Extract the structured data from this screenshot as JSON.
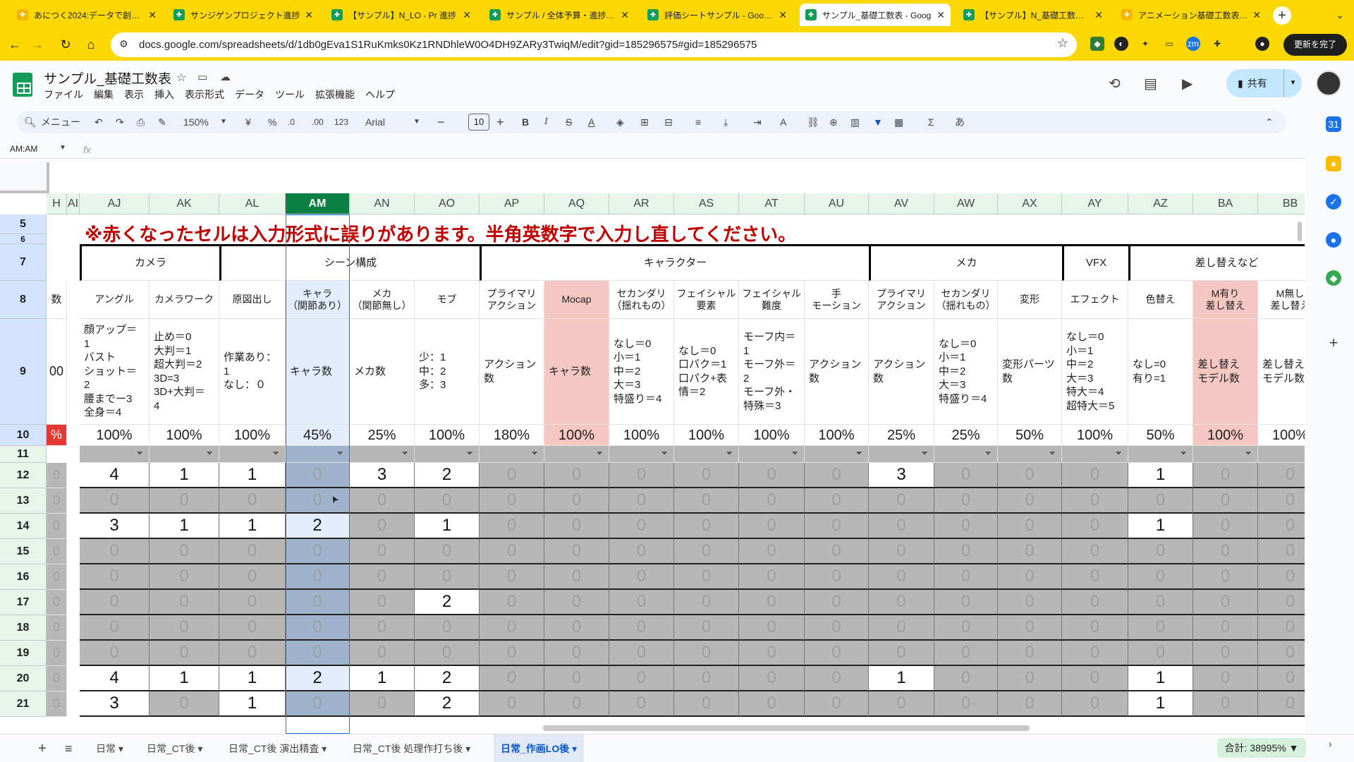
{
  "browser": {
    "tabs": [
      {
        "title": "あにつく2024:データで創る…",
        "icon_color": "#f4b400"
      },
      {
        "title": "サンジゲンプロジェクト進捗",
        "icon_color": "#0f9d58"
      },
      {
        "title": "【サンプル】N_LO - Pr 進捗",
        "icon_color": "#0f9d58"
      },
      {
        "title": "サンプル / 全体予算・進捗 - …",
        "icon_color": "#0f9d58"
      },
      {
        "title": "評価シートサンプル - Google",
        "icon_color": "#0f9d58"
      },
      {
        "title": "サンプル_基礎工数表 - Goog",
        "icon_color": "#0f9d58"
      },
      {
        "title": "【サンプル】N_基礎工数表…",
        "icon_color": "#0f9d58"
      },
      {
        "title": "アニメーション基礎工数表マ…",
        "icon_color": "#f4b400"
      }
    ],
    "active_tab": 5,
    "url": "docs.google.com/spreadsheets/d/1db0gEva1S1RuKmks0Kz1RNDhleW0O4DH9ZARy3TwiqM/edit?gid=185296575#gid=185296575",
    "update_label": "更新を完了",
    "newtab_label": "+"
  },
  "doc": {
    "title": "サンプル_基礎工数表",
    "menu": [
      "ファイル",
      "編集",
      "表示",
      "挿入",
      "表示形式",
      "データ",
      "ツール",
      "拡張機能",
      "ヘルプ"
    ],
    "share_label": "共有"
  },
  "toolbar": {
    "search_label": "メニュー",
    "zoom": "150%",
    "currency": "¥",
    "percent": "%",
    "dec_less": ".0",
    "dec_more": ".00",
    "format_123": "123",
    "font": "Arial",
    "font_size": "10",
    "input_mode": "あ"
  },
  "formula": {
    "name_box": "AM:AM",
    "fx": "fx"
  },
  "grid": {
    "col_headers": [
      "H",
      "AI",
      "AJ",
      "AK",
      "AL",
      "AM",
      "AN",
      "AO",
      "AP",
      "AQ",
      "AR",
      "AS",
      "AT",
      "AU",
      "AV",
      "AW",
      "AX",
      "AY",
      "AZ",
      "BA",
      "BB"
    ],
    "selected_col": "AM",
    "row_numbers": [
      "5",
      "6",
      "7",
      "8",
      "9",
      "10",
      "11",
      "12",
      "13",
      "14",
      "15",
      "16",
      "17",
      "18",
      "19",
      "20",
      "21"
    ],
    "warning": "※赤くなったセルは入力形式に誤りがあります。半角英数字で入力し直してください。",
    "groups": [
      {
        "label": "カメラ"
      },
      {
        "label": "シーン構成"
      },
      {
        "label": "キャラクター"
      },
      {
        "label": "メカ"
      },
      {
        "label": "VFX"
      },
      {
        "label": "差し替えなど"
      }
    ],
    "left_partial": {
      "row8": "数",
      "row9": "00",
      "row10": "%"
    },
    "subheaders": [
      "アングル",
      "カメラワーク",
      "原図出し",
      "キャラ\n（関節あり）",
      "メカ\n（関節無し）",
      "モブ",
      "プライマリ\nアクション",
      "Mocap",
      "セカンダリ\n（揺れもの）",
      "フェイシャル\n要素",
      "フェイシャル\n難度",
      "手\nモーション",
      "プライマリ\nアクション",
      "セカンダリ\n（揺れもの）",
      "変形",
      "エフェクト",
      "色替え",
      "M有り\n差し替え",
      "M無し\n差し替え"
    ],
    "notes": [
      "顔アップ＝\n1\nバスト\nショット＝\n2\n腰までー3\n全身＝4",
      "止め＝0\n大判＝1\n超大判＝2\n3D=3\n3D+大判＝\n4",
      "作業あり：\n1\nなし：０",
      "キャラ数",
      "メカ数",
      "少：1\n中：2\n多：3",
      "アクション\n数",
      "キャラ数",
      "なし＝0\n小＝1\n中＝2\n大＝3\n特盛り＝4",
      "なし＝0\n口パク＝1\n口パク+表\n情＝2",
      "モーフ内＝\n1\nモーフ外＝\n2\nモーフ外・\n特殊＝3",
      "アクション\n数",
      "アクション\n数",
      "なし＝0\n小＝1\n中＝2\n大＝3\n特盛り＝4",
      "変形パーツ\n数",
      "なし＝0\n小＝1\n中＝2\n大＝3\n特大＝4\n超特大＝5",
      "なし=0\n有り=1",
      "差し替え\nモデル数",
      "差し替え\nモデル数"
    ],
    "percents": [
      "100%",
      "100%",
      "100%",
      "45%",
      "25%",
      "100%",
      "180%",
      "100%",
      "100%",
      "100%",
      "100%",
      "100%",
      "25%",
      "25%",
      "50%",
      "100%",
      "50%",
      "100%",
      "100%"
    ],
    "data_rows": [
      {
        "row": "12",
        "values": [
          "4",
          "1",
          "1",
          "0",
          "3",
          "2",
          "0",
          "0",
          "0",
          "0",
          "0",
          "0",
          "3",
          "0",
          "0",
          "0",
          "1",
          "0",
          "0"
        ]
      },
      {
        "row": "13",
        "values": [
          "0",
          "0",
          "0",
          "0",
          "0",
          "0",
          "0",
          "0",
          "0",
          "0",
          "0",
          "0",
          "0",
          "0",
          "0",
          "0",
          "0",
          "0",
          "0"
        ]
      },
      {
        "row": "14",
        "values": [
          "3",
          "1",
          "1",
          "2",
          "0",
          "1",
          "0",
          "0",
          "0",
          "0",
          "0",
          "0",
          "0",
          "0",
          "0",
          "0",
          "1",
          "0",
          "0"
        ]
      },
      {
        "row": "15",
        "values": [
          "0",
          "0",
          "0",
          "0",
          "0",
          "0",
          "0",
          "0",
          "0",
          "0",
          "0",
          "0",
          "0",
          "0",
          "0",
          "0",
          "0",
          "0",
          "0"
        ]
      },
      {
        "row": "16",
        "values": [
          "0",
          "0",
          "0",
          "0",
          "0",
          "0",
          "0",
          "0",
          "0",
          "0",
          "0",
          "0",
          "0",
          "0",
          "0",
          "0",
          "0",
          "0",
          "0"
        ]
      },
      {
        "row": "17",
        "values": [
          "0",
          "0",
          "0",
          "0",
          "0",
          "2",
          "0",
          "0",
          "0",
          "0",
          "0",
          "0",
          "0",
          "0",
          "0",
          "0",
          "0",
          "0",
          "0"
        ]
      },
      {
        "row": "18",
        "values": [
          "0",
          "0",
          "0",
          "0",
          "0",
          "0",
          "0",
          "0",
          "0",
          "0",
          "0",
          "0",
          "0",
          "0",
          "0",
          "0",
          "0",
          "0",
          "0"
        ]
      },
      {
        "row": "19",
        "values": [
          "0",
          "0",
          "0",
          "0",
          "0",
          "0",
          "0",
          "0",
          "0",
          "0",
          "0",
          "0",
          "0",
          "0",
          "0",
          "0",
          "0",
          "0",
          "0"
        ]
      },
      {
        "row": "20",
        "values": [
          "4",
          "1",
          "1",
          "2",
          "1",
          "2",
          "0",
          "0",
          "0",
          "0",
          "0",
          "0",
          "1",
          "0",
          "0",
          "0",
          "1",
          "0",
          "0"
        ]
      },
      {
        "row": "21",
        "values": [
          "3",
          "0",
          "1",
          "0",
          "0",
          "2",
          "0",
          "0",
          "0",
          "0",
          "0",
          "0",
          "0",
          "0",
          "0",
          "0",
          "1",
          "0",
          "0"
        ]
      }
    ]
  },
  "sheets": {
    "tabs": [
      "日常",
      "日常_CT後",
      "日常_CT後 演出精査",
      "日常_CT後 処理作打ち後",
      "日常_作画LO後"
    ],
    "active": 4,
    "sum": "合計: 38995%"
  }
}
